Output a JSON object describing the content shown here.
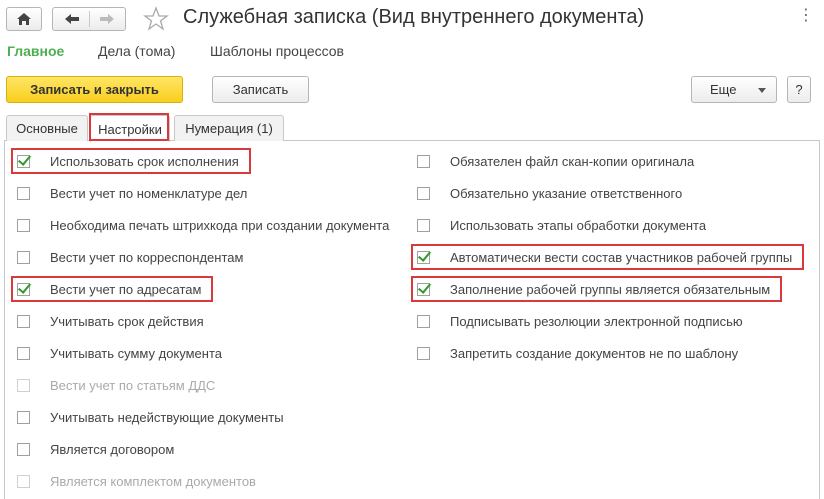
{
  "window": {
    "title": "Служебная записка (Вид внутреннего документа)",
    "close_glyph": "×",
    "more_glyph": "⋮"
  },
  "sections": [
    "Главное",
    "Дела (тома)",
    "Шаблоны процессов"
  ],
  "toolbar": {
    "save_close": "Записать и закрыть",
    "save": "Записать",
    "more": "Еще",
    "help": "?"
  },
  "tabs": [
    {
      "label": "Основные",
      "active": false
    },
    {
      "label": "Настройки",
      "active": true
    },
    {
      "label": "Нумерация (1)",
      "active": false
    }
  ],
  "left_options": [
    {
      "label": "Использовать срок исполнения",
      "checked": true,
      "enabled": true,
      "highlighted": true
    },
    {
      "label": "Вести учет по номенклатуре дел",
      "checked": false,
      "enabled": true,
      "highlighted": false
    },
    {
      "label": "Необходима печать штрихкода при создании документа",
      "checked": false,
      "enabled": true,
      "highlighted": false
    },
    {
      "label": "Вести учет по корреспондентам",
      "checked": false,
      "enabled": true,
      "highlighted": false
    },
    {
      "label": "Вести учет по адресатам",
      "checked": true,
      "enabled": true,
      "highlighted": true
    },
    {
      "label": "Учитывать срок действия",
      "checked": false,
      "enabled": true,
      "highlighted": false
    },
    {
      "label": "Учитывать сумму документа",
      "checked": false,
      "enabled": true,
      "highlighted": false
    },
    {
      "label": "Вести учет по статьям ДДС",
      "checked": false,
      "enabled": false,
      "highlighted": false
    },
    {
      "label": "Учитывать недействующие документы",
      "checked": false,
      "enabled": true,
      "highlighted": false
    },
    {
      "label": "Является договором",
      "checked": false,
      "enabled": true,
      "highlighted": false
    },
    {
      "label": "Является комплектом документов",
      "checked": false,
      "enabled": false,
      "highlighted": false
    }
  ],
  "right_options": [
    {
      "label": "Обязателен файл скан-копии оригинала",
      "checked": false,
      "enabled": true,
      "highlighted": false
    },
    {
      "label": "Обязательно указание ответственного",
      "checked": false,
      "enabled": true,
      "highlighted": false
    },
    {
      "label": "Использовать этапы обработки документа",
      "checked": false,
      "enabled": true,
      "highlighted": false
    },
    {
      "label": "Автоматически вести состав участников рабочей группы",
      "checked": true,
      "enabled": true,
      "highlighted": true
    },
    {
      "label": "Заполнение рабочей группы является обязательным",
      "checked": true,
      "enabled": true,
      "highlighted": true
    },
    {
      "label": "Подписывать резолюции электронной подписью",
      "checked": false,
      "enabled": true,
      "highlighted": false
    },
    {
      "label": "Запретить создание документов не по шаблону",
      "checked": false,
      "enabled": true,
      "highlighted": false
    }
  ],
  "colors": {
    "primary_button": "#f8cf1c",
    "active_section": "#4caf50",
    "highlight": "#d9393b",
    "check": "#2e9a2e"
  }
}
